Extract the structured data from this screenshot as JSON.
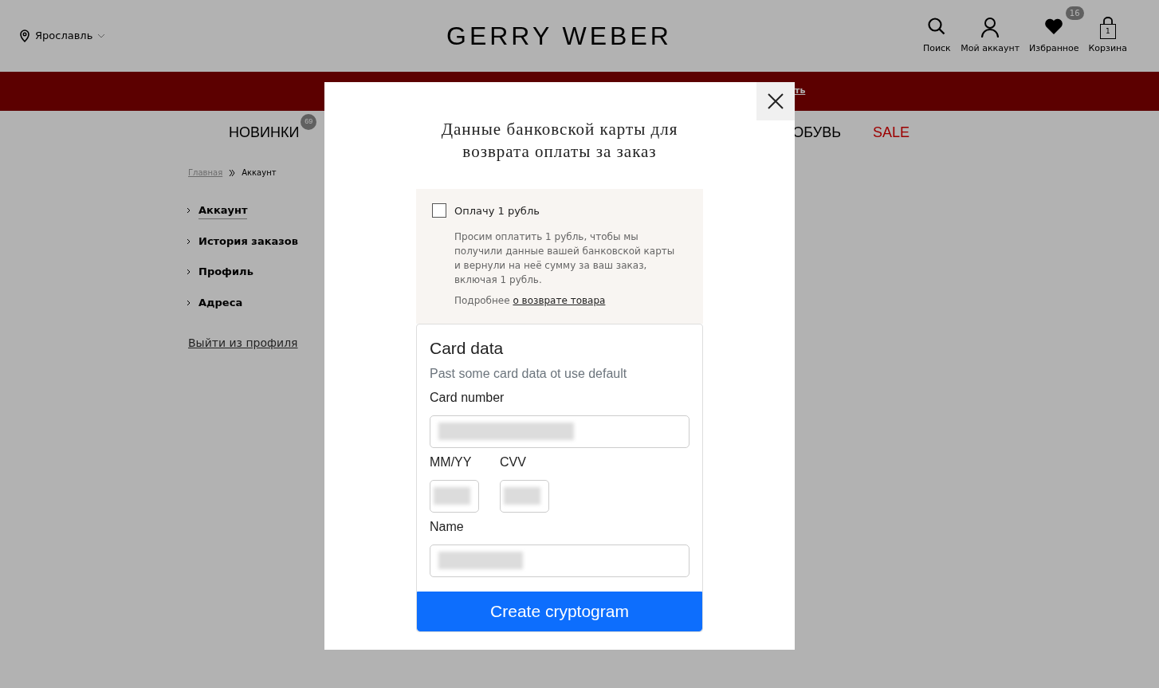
{
  "header": {
    "city": "Ярославль",
    "logo": "GERRY WEBER",
    "actions": [
      {
        "kind": "search",
        "label": "Поиск"
      },
      {
        "kind": "account",
        "label": "Мой аккаунт"
      },
      {
        "kind": "favorites",
        "label": "Избранное",
        "badge": "16"
      },
      {
        "kind": "cart",
        "label": "Корзина",
        "count": "1"
      }
    ]
  },
  "banner": {
    "link_text": "ть"
  },
  "nav": [
    {
      "label": "НОВИНКИ",
      "badge": "69",
      "sale": false
    },
    {
      "label": "ОБУВЬ",
      "sale": false
    },
    {
      "label": "SALE",
      "sale": true
    }
  ],
  "breadcrumbs": [
    "Главная",
    "Аккаунт"
  ],
  "sidebar": {
    "items": [
      {
        "label": "Аккаунт",
        "selected": true
      },
      {
        "label": "История заказов",
        "selected": false
      },
      {
        "label": "Профиль",
        "selected": false
      },
      {
        "label": "Адреса",
        "selected": false
      }
    ],
    "logout": "Выйти из профиля"
  },
  "modal": {
    "title": "Данные банковской карты для возврата оплаты за заказ",
    "offer": {
      "label": "Оплачу 1 рубль",
      "checked": false,
      "description": "Просим оплатить 1 рубль, чтобы мы получили данные вашей банковской карты и вернули на неё сумму за ваш заказ, включая 1 рубль.",
      "more_prefix": "Подробнее",
      "more_link": "о возврате товара"
    },
    "card": {
      "title": "Card data",
      "subtitle": "Past some card data ot use default",
      "fields": [
        {
          "label": "Card number",
          "kind": "wide"
        },
        {
          "label": "MM/YY",
          "kind": "short"
        },
        {
          "label": "CVV",
          "kind": "short"
        },
        {
          "label": "Name",
          "kind": "wide"
        }
      ],
      "button": "Create cryptogram"
    }
  }
}
